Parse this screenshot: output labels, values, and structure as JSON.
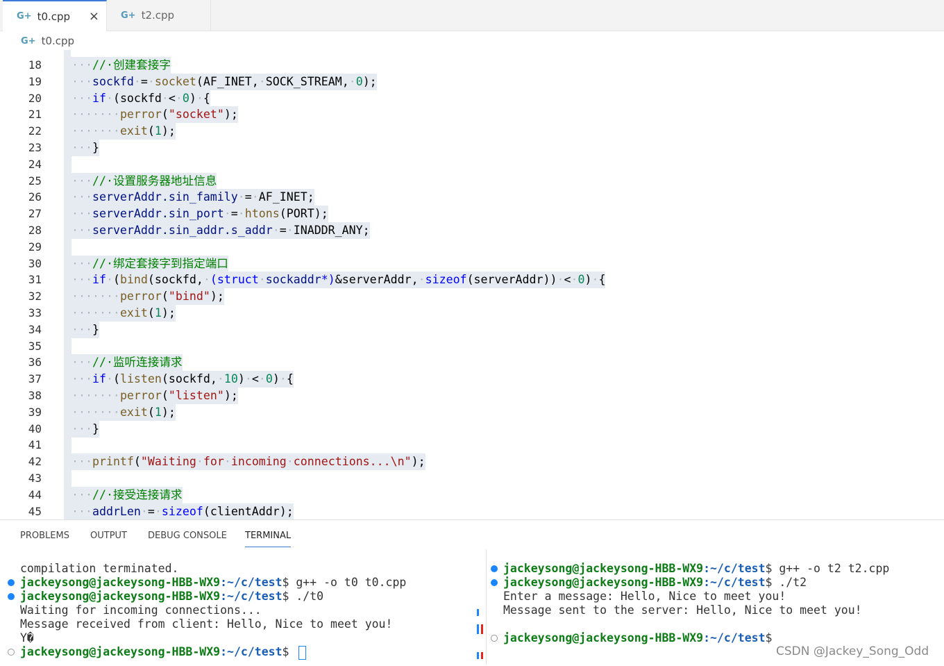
{
  "tabs": [
    {
      "label": "t0.cpp",
      "icon": "c-plus-plus-file-icon"
    },
    {
      "label": "t2.cpp",
      "icon": "c-plus-plus-file-icon"
    }
  ],
  "breadcrumb": "t0.cpp",
  "editor_lines": [
    {
      "n": "18",
      "tokens": [
        [
          "ws",
          "····"
        ],
        [
          "cm",
          "//·创建套接字"
        ]
      ]
    },
    {
      "n": "19",
      "tokens": [
        [
          "ws",
          "····"
        ],
        [
          "vr",
          "sockfd"
        ],
        [
          "ws",
          "·"
        ],
        [
          "",
          "="
        ],
        [
          "ws",
          "·"
        ],
        [
          "fn",
          "socket"
        ],
        [
          "",
          "(AF_INET,"
        ],
        [
          "ws",
          "·"
        ],
        [
          "",
          "SOCK_STREAM,"
        ],
        [
          "ws",
          "·"
        ],
        [
          "nm",
          "0"
        ],
        [
          "",
          ");"
        ]
      ]
    },
    {
      "n": "20",
      "tokens": [
        [
          "ws",
          "····"
        ],
        [
          "kw",
          "if"
        ],
        [
          "ws",
          "·"
        ],
        [
          "",
          "(sockfd"
        ],
        [
          "ws",
          "·"
        ],
        [
          "",
          "<"
        ],
        [
          "ws",
          "·"
        ],
        [
          "nm",
          "0"
        ],
        [
          "",
          ")"
        ],
        [
          "ws",
          "·"
        ],
        [
          "",
          "{"
        ]
      ]
    },
    {
      "n": "21",
      "tokens": [
        [
          "ws",
          "········"
        ],
        [
          "fn",
          "perror"
        ],
        [
          "",
          "("
        ],
        [
          "st",
          "\"socket\""
        ],
        [
          "",
          ");"
        ]
      ]
    },
    {
      "n": "22",
      "tokens": [
        [
          "ws",
          "········"
        ],
        [
          "fn",
          "exit"
        ],
        [
          "",
          "("
        ],
        [
          "nm",
          "1"
        ],
        [
          "",
          ");"
        ]
      ]
    },
    {
      "n": "23",
      "tokens": [
        [
          "ws",
          "····"
        ],
        [
          "",
          "}"
        ]
      ]
    },
    {
      "n": "24",
      "tokens": []
    },
    {
      "n": "25",
      "tokens": [
        [
          "ws",
          "····"
        ],
        [
          "cm",
          "//·设置服务器地址信息"
        ]
      ]
    },
    {
      "n": "26",
      "tokens": [
        [
          "ws",
          "····"
        ],
        [
          "vr",
          "serverAddr.sin_family"
        ],
        [
          "ws",
          "·"
        ],
        [
          "",
          "="
        ],
        [
          "ws",
          "·"
        ],
        [
          "",
          "AF_INET;"
        ]
      ]
    },
    {
      "n": "27",
      "tokens": [
        [
          "ws",
          "····"
        ],
        [
          "vr",
          "serverAddr.sin_port"
        ],
        [
          "ws",
          "·"
        ],
        [
          "",
          "="
        ],
        [
          "ws",
          "·"
        ],
        [
          "fn",
          "htons"
        ],
        [
          "",
          "(PORT);"
        ]
      ]
    },
    {
      "n": "28",
      "tokens": [
        [
          "ws",
          "····"
        ],
        [
          "vr",
          "serverAddr.sin_addr.s_addr"
        ],
        [
          "ws",
          "·"
        ],
        [
          "",
          "="
        ],
        [
          "ws",
          "·"
        ],
        [
          "",
          "INADDR_ANY;"
        ]
      ]
    },
    {
      "n": "29",
      "tokens": []
    },
    {
      "n": "30",
      "tokens": [
        [
          "ws",
          "····"
        ],
        [
          "cm",
          "//·绑定套接字到指定端口"
        ]
      ]
    },
    {
      "n": "31",
      "tokens": [
        [
          "ws",
          "····"
        ],
        [
          "kw",
          "if"
        ],
        [
          "ws",
          "·"
        ],
        [
          "",
          "("
        ],
        [
          "fn",
          "bind"
        ],
        [
          "",
          "(sockfd,"
        ],
        [
          "ws",
          "·"
        ],
        [
          "kw",
          "(struct"
        ],
        [
          "ws",
          "·"
        ],
        [
          "vr",
          "sockaddr"
        ],
        [
          "kw",
          "*)"
        ],
        [
          "",
          "&serverAddr,"
        ],
        [
          "ws",
          "·"
        ],
        [
          "kw",
          "sizeof"
        ],
        [
          "",
          "(serverAddr))"
        ],
        [
          "ws",
          "·"
        ],
        [
          "",
          "<"
        ],
        [
          "ws",
          "·"
        ],
        [
          "nm",
          "0"
        ],
        [
          "",
          ")"
        ],
        [
          "ws",
          "·"
        ],
        [
          "",
          "{"
        ]
      ]
    },
    {
      "n": "32",
      "tokens": [
        [
          "ws",
          "········"
        ],
        [
          "fn",
          "perror"
        ],
        [
          "",
          "("
        ],
        [
          "st",
          "\"bind\""
        ],
        [
          "",
          ");"
        ]
      ]
    },
    {
      "n": "33",
      "tokens": [
        [
          "ws",
          "········"
        ],
        [
          "fn",
          "exit"
        ],
        [
          "",
          "("
        ],
        [
          "nm",
          "1"
        ],
        [
          "",
          ");"
        ]
      ]
    },
    {
      "n": "34",
      "tokens": [
        [
          "ws",
          "····"
        ],
        [
          "",
          "}"
        ]
      ]
    },
    {
      "n": "35",
      "tokens": []
    },
    {
      "n": "36",
      "tokens": [
        [
          "ws",
          "····"
        ],
        [
          "cm",
          "//·监听连接请求"
        ]
      ]
    },
    {
      "n": "37",
      "tokens": [
        [
          "ws",
          "····"
        ],
        [
          "kw",
          "if"
        ],
        [
          "ws",
          "·"
        ],
        [
          "",
          "("
        ],
        [
          "fn",
          "listen"
        ],
        [
          "",
          "(sockfd,"
        ],
        [
          "ws",
          "·"
        ],
        [
          "nm",
          "10"
        ],
        [
          "",
          ")"
        ],
        [
          "ws",
          "·"
        ],
        [
          "",
          "<"
        ],
        [
          "ws",
          "·"
        ],
        [
          "nm",
          "0"
        ],
        [
          "",
          ")"
        ],
        [
          "ws",
          "·"
        ],
        [
          "",
          "{"
        ]
      ]
    },
    {
      "n": "38",
      "tokens": [
        [
          "ws",
          "········"
        ],
        [
          "fn",
          "perror"
        ],
        [
          "",
          "("
        ],
        [
          "st",
          "\"listen\""
        ],
        [
          "",
          ");"
        ]
      ]
    },
    {
      "n": "39",
      "tokens": [
        [
          "ws",
          "········"
        ],
        [
          "fn",
          "exit"
        ],
        [
          "",
          "("
        ],
        [
          "nm",
          "1"
        ],
        [
          "",
          ");"
        ]
      ]
    },
    {
      "n": "40",
      "tokens": [
        [
          "ws",
          "····"
        ],
        [
          "",
          "}"
        ]
      ]
    },
    {
      "n": "41",
      "tokens": []
    },
    {
      "n": "42",
      "tokens": [
        [
          "ws",
          "····"
        ],
        [
          "fn",
          "printf"
        ],
        [
          "",
          "("
        ],
        [
          "st",
          "\"Waiting"
        ],
        [
          "ws",
          "·"
        ],
        [
          "st",
          "for"
        ],
        [
          "ws",
          "·"
        ],
        [
          "st",
          "incoming"
        ],
        [
          "ws",
          "·"
        ],
        [
          "st",
          "connections...\\n\""
        ],
        [
          "",
          ");"
        ]
      ]
    },
    {
      "n": "43",
      "tokens": []
    },
    {
      "n": "44",
      "tokens": [
        [
          "ws",
          "····"
        ],
        [
          "cm",
          "//·接受连接请求"
        ]
      ]
    },
    {
      "n": "45",
      "tokens": [
        [
          "ws",
          "····"
        ],
        [
          "vr",
          "addrLen"
        ],
        [
          "ws",
          "·"
        ],
        [
          "",
          "="
        ],
        [
          "ws",
          "·"
        ],
        [
          "kw",
          "sizeof"
        ],
        [
          "",
          "(clientAddr);"
        ]
      ]
    }
  ],
  "panel_tabs": [
    "PROBLEMS",
    "OUTPUT",
    "DEBUG CONSOLE",
    "TERMINAL"
  ],
  "terminal_left": [
    {
      "dot": "none",
      "prompt": "",
      "path": "",
      "text": "compilation terminated."
    },
    {
      "dot": "filled",
      "prompt": "jackeysong@jackeysong-HBB-WX9",
      "path": ":~/c/test",
      "text": "$ g++ -o t0 t0.cpp"
    },
    {
      "dot": "filled",
      "prompt": "jackeysong@jackeysong-HBB-WX9",
      "path": ":~/c/test",
      "text": "$ ./t0"
    },
    {
      "dot": "none",
      "prompt": "",
      "path": "",
      "text": "Waiting for incoming connections..."
    },
    {
      "dot": "none",
      "prompt": "",
      "path": "",
      "text": "Message received from client: Hello, Nice to meet you!"
    },
    {
      "dot": "none",
      "prompt": "",
      "path": "",
      "text": "Y�"
    },
    {
      "dot": "hollow",
      "prompt": "jackeysong@jackeysong-HBB-WX9",
      "path": ":~/c/test",
      "text": "$ "
    }
  ],
  "terminal_right": [
    {
      "dot": "filled",
      "prompt": "jackeysong@jackeysong-HBB-WX9",
      "path": ":~/c/test",
      "text": "$ g++ -o t2 t2.cpp"
    },
    {
      "dot": "filled",
      "prompt": "jackeysong@jackeysong-HBB-WX9",
      "path": ":~/c/test",
      "text": "$ ./t2"
    },
    {
      "dot": "none",
      "prompt": "",
      "path": "",
      "text": "Enter a message: Hello, Nice to meet you!"
    },
    {
      "dot": "none",
      "prompt": "",
      "path": "",
      "text": "Message sent to the server: Hello, Nice to meet you!"
    },
    {
      "dot": "none",
      "prompt": "",
      "path": "",
      "text": ""
    },
    {
      "dot": "hollow",
      "prompt": "jackeysong@jackeysong-HBB-WX9",
      "path": ":~/c/test",
      "text": "$"
    }
  ],
  "watermark": "CSDN @Jackey_Song_Odd",
  "colors": {
    "accent": "#3b7bd6",
    "line_highlight": "#e5ebf1",
    "prompt_green": "#0e7c16",
    "path_blue": "#1a5fb4"
  }
}
